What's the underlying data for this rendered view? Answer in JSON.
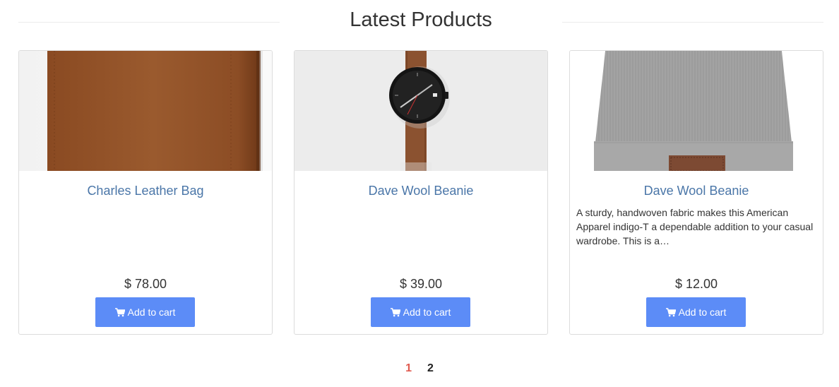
{
  "section": {
    "title": "Latest Products"
  },
  "products": [
    {
      "title": "Charles Leather Bag",
      "description": "",
      "price": "$ 78.00",
      "button_label": "Add to cart",
      "image_icon": "leather-wallet-image"
    },
    {
      "title": "Dave Wool Beanie",
      "description": "",
      "price": "$ 39.00",
      "button_label": "Add to cart",
      "image_icon": "wristwatch-image"
    },
    {
      "title": "Dave Wool Beanie",
      "description": "A sturdy, handwoven fabric makes this American Apparel indigo-T a dependable addition to your casual wardrobe. This is a…",
      "price": "$ 12.00",
      "button_label": "Add to cart",
      "image_icon": "wool-beanie-image"
    }
  ],
  "pagination": {
    "pages": [
      "1",
      "2"
    ],
    "current": "1"
  },
  "colors": {
    "title_link": "#4a76a8",
    "button": "#5c8cf7",
    "active_page": "#e05a4f"
  }
}
